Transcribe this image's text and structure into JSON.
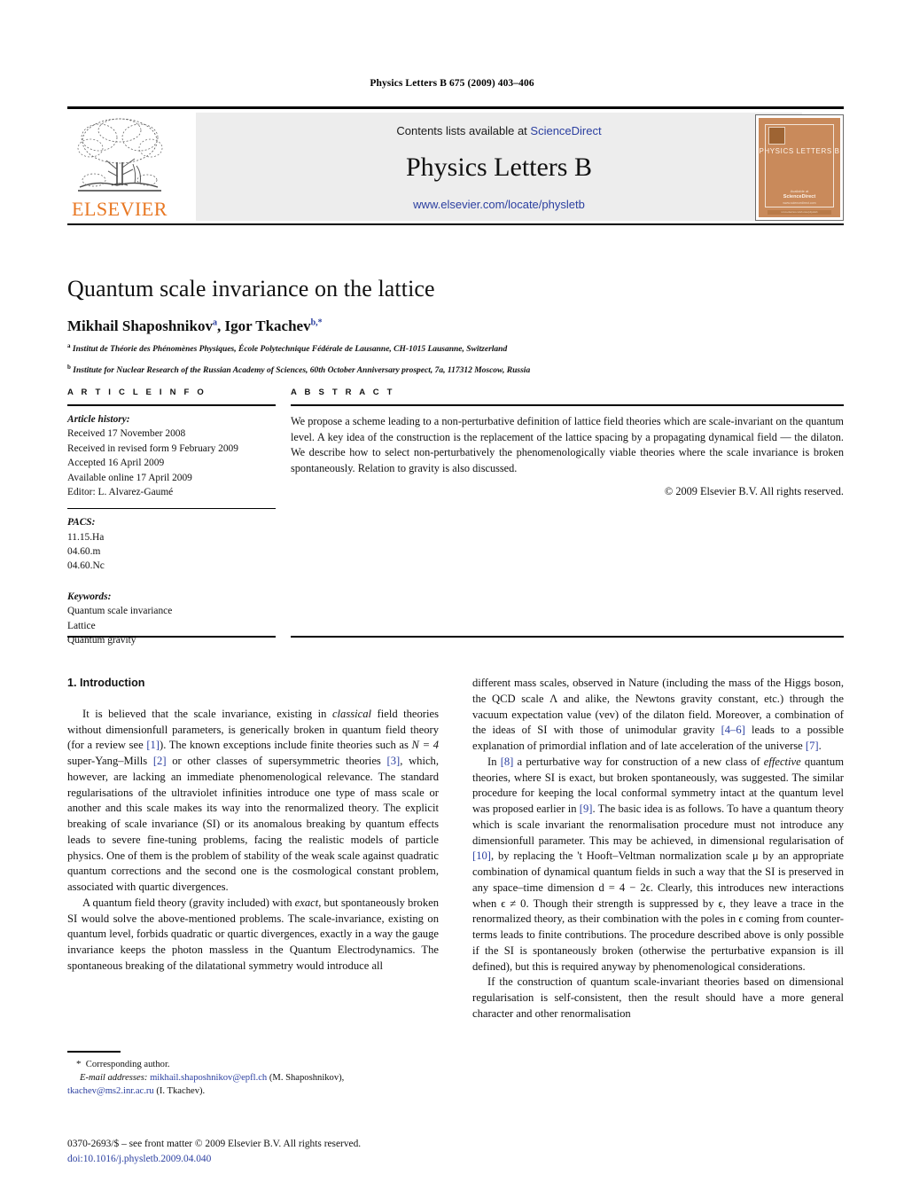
{
  "running_head": "Physics Letters B 675 (2009) 403–406",
  "masthead": {
    "contents_prefix": "Contents lists available at ",
    "sciencedirect": "ScienceDirect",
    "journal_name": "Physics Letters B",
    "journal_url": "www.elsevier.com/locate/physletb",
    "publisher": "ELSEVIER",
    "link_color": "#2B3FA0",
    "publisher_color": "#E87722",
    "cover": {
      "title": "PHYSICS LETTERS B",
      "foot1": "Available at",
      "foot2": "ScienceDirect",
      "foot3": "www.sciencedirect.com",
      "bottom_bar": "www.elsevier.com/locate/physletb",
      "bg_color": "#C98A5B"
    }
  },
  "title_block": {
    "title": "Quantum scale invariance on the lattice",
    "authors": [
      {
        "name": "Mikhail Shaposhnikov",
        "marks": "a"
      },
      {
        "name": "Igor Tkachev",
        "marks": "b,*"
      }
    ],
    "affiliations": [
      {
        "mark": "a",
        "text": "Institut de Théorie des Phénomènes Physiques, École Polytechnique Fédérale de Lausanne, CH-1015 Lausanne, Switzerland"
      },
      {
        "mark": "b",
        "text": "Institute for Nuclear Research of the Russian Academy of Sciences, 60th October Anniversary prospect, 7a, 117312 Moscow, Russia"
      }
    ]
  },
  "article_info": {
    "heading": "A R T I C L E   I N F O",
    "history_label": "Article history:",
    "history": [
      "Received 17 November 2008",
      "Received in revised form 9 February 2009",
      "Accepted 16 April 2009",
      "Available online 17 April 2009",
      "Editor: L. Alvarez-Gaumé"
    ],
    "pacs_label": "PACS:",
    "pacs": [
      "11.15.Ha",
      "04.60.m",
      "04.60.Nc"
    ],
    "keywords_label": "Keywords:",
    "keywords": [
      "Quantum scale invariance",
      "Lattice",
      "Quantum gravity"
    ]
  },
  "abstract": {
    "heading": "A B S T R A C T",
    "text": "We propose a scheme leading to a non-perturbative definition of lattice field theories which are scale-invariant on the quantum level. A key idea of the construction is the replacement of the lattice spacing by a propagating dynamical field — the dilaton. We describe how to select non-perturbatively the phenomenologically viable theories where the scale invariance is broken spontaneously. Relation to gravity is also discussed.",
    "copyright": "© 2009 Elsevier B.V. All rights reserved."
  },
  "body": {
    "section_heading": "1. Introduction",
    "left_p1_a": "It is believed that the scale invariance, existing in ",
    "left_p1_italic1": "classical",
    "left_p1_b": " field theories without dimensionfull parameters, is generically broken in quantum field theory (for a review see ",
    "left_p1_ref1": "[1]",
    "left_p1_c": "). The known exceptions include finite theories such as ",
    "left_p1_math": "N = 4",
    "left_p1_d": " super-Yang–Mills ",
    "left_p1_ref2": "[2]",
    "left_p1_e": " or other classes of supersymmetric theories ",
    "left_p1_ref3": "[3]",
    "left_p1_f": ", which, however, are lacking an immediate phenomenological relevance. The standard regularisations of the ultraviolet infinities introduce one type of mass scale or another and this scale makes its way into the renormalized theory. The explicit breaking of scale invariance (SI) or its anomalous breaking by quantum effects leads to severe fine-tuning problems, facing the realistic models of particle physics. One of them is the problem of stability of the weak scale against quadratic quantum corrections and the second one is the cosmological constant problem, associated with quartic divergences.",
    "left_p2_a": "A quantum field theory (gravity included) with ",
    "left_p2_italic1": "exact",
    "left_p2_b": ", but spontaneously broken SI would solve the above-mentioned problems. The scale-invariance, existing on quantum level, forbids quadratic or quartic divergences, exactly in a way the gauge invariance keeps the photon massless in the Quantum Electrodynamics. The spontaneous breaking of the dilatational symmetry would introduce all",
    "right_p1": "different mass scales, observed in Nature (including the mass of the Higgs boson, the QCD scale Λ and alike, the Newtons gravity constant, etc.) through the vacuum expectation value (vev) of the dilaton field. Moreover, a combination of the ideas of SI with those of unimodular gravity ",
    "right_p1_ref1": "[4–6]",
    "right_p1_b": " leads to a possible explanation of primordial inflation and of late acceleration of the universe ",
    "right_p1_ref2": "[7]",
    "right_p1_c": ".",
    "right_p2_a": "In ",
    "right_p2_ref1": "[8]",
    "right_p2_b": " a perturbative way for construction of a new class of ",
    "right_p2_italic1": "effective",
    "right_p2_c": " quantum theories, where SI is exact, but broken spontaneously, was suggested. The similar procedure for keeping the local conformal symmetry intact at the quantum level was proposed earlier in ",
    "right_p2_ref2": "[9]",
    "right_p2_d": ". The basic idea is as follows. To have a quantum theory which is scale invariant the renormalisation procedure must not introduce any dimensionfull parameter. This may be achieved, in dimensional regularisation of ",
    "right_p2_ref3": "[10]",
    "right_p2_e": ", by replacing the 't Hooft–Veltman normalization scale μ by an appropriate combination of dynamical quantum fields in such a way that the SI is preserved in any space–time dimension d = 4 − 2ϵ. Clearly, this introduces new interactions when ϵ ≠ 0. Though their strength is suppressed by ϵ, they leave a trace in the renormalized theory, as their combination with the poles in ϵ coming from counter-terms leads to finite contributions. The procedure described above is only possible if the SI is spontaneously broken (otherwise the perturbative expansion is ill defined), but this is required anyway by phenomenological considerations.",
    "right_p3": "If the construction of quantum scale-invariant theories based on dimensional regularisation is self-consistent, then the result should have a more general character and other renormalisation"
  },
  "footnote": {
    "corresponding": "Corresponding author.",
    "email_label": "E-mail addresses:",
    "email1": "mikhail.shaposhnikov@epfl.ch",
    "email1_owner": "(M. Shaposhnikov),",
    "email2": "tkachev@ms2.inr.ac.ru",
    "email2_owner": "(I. Tkachev)."
  },
  "imprint": {
    "line1": "0370-2693/$ – see front matter © 2009 Elsevier B.V. All rights reserved.",
    "doi": "doi:10.1016/j.physletb.2009.04.040"
  }
}
